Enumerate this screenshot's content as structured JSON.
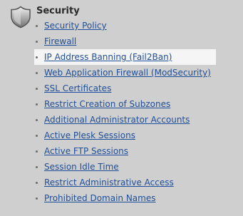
{
  "section": {
    "title": "Security",
    "icon": "shield-icon",
    "link_color": "#1f4f99",
    "items": [
      {
        "label": "Security Policy"
      },
      {
        "label": "Firewall"
      },
      {
        "label": "IP Address Banning (Fail2Ban)",
        "selected": true
      },
      {
        "label": "Web Application Firewall (ModSecurity)"
      },
      {
        "label": "SSL Certificates"
      },
      {
        "label": "Restrict Creation of Subzones"
      },
      {
        "label": "Additional Administrator Accounts"
      },
      {
        "label": "Active Plesk Sessions"
      },
      {
        "label": "Active FTP Sessions"
      },
      {
        "label": "Session Idle Time"
      },
      {
        "label": "Restrict Administrative Access"
      },
      {
        "label": "Prohibited Domain Names"
      }
    ]
  }
}
